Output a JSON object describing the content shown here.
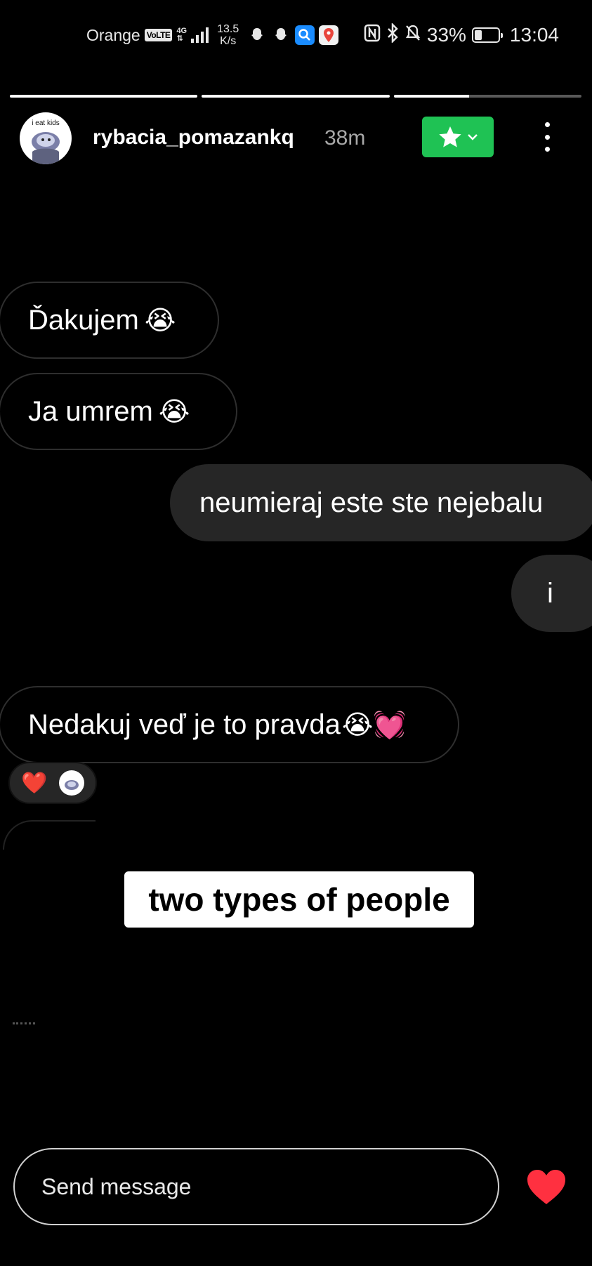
{
  "status_bar": {
    "carrier": "Orange",
    "volte": "VoLTE",
    "network": "4G",
    "speed_value": "13.5",
    "speed_unit": "K/s",
    "battery": "33%",
    "battery_level": 0.33,
    "time": "13:04"
  },
  "story": {
    "segments": [
      1.0,
      1.0,
      0.4
    ]
  },
  "header": {
    "avatar_text": "i eat kids",
    "username": "rybacia_pomazankq",
    "time_ago": "38m"
  },
  "messages": [
    {
      "text": "Ďakujem",
      "emoji": "😭",
      "direction": "incoming"
    },
    {
      "text": "Ja umrem",
      "emoji": "😭",
      "direction": "incoming"
    },
    {
      "text": "neumieraj este ste nejebalu",
      "emoji": "",
      "direction": "outgoing"
    },
    {
      "text": "i",
      "emoji": "",
      "direction": "outgoing"
    },
    {
      "text": "Nedakuj veď je to pravda",
      "emoji": "😭💓",
      "direction": "incoming"
    }
  ],
  "reaction": {
    "emoji": "❤️"
  },
  "caption": "two types of people",
  "reply": {
    "placeholder": "Send message"
  },
  "colors": {
    "background": "#000000",
    "outgoing_bubble": "#262626",
    "close_friends_green": "#1fc254",
    "like_red": "#ff3040"
  }
}
